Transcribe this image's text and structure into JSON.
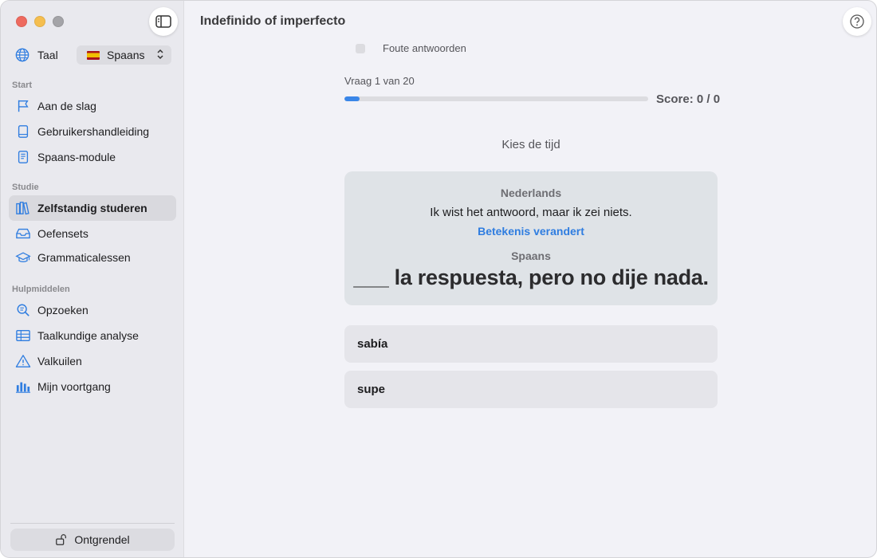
{
  "sidebar": {
    "language_label": "Taal",
    "language_value": "Spaans",
    "sections": {
      "start": "Start",
      "study": "Studie",
      "tools": "Hulpmiddelen"
    },
    "items": [
      {
        "label": "Aan de slag",
        "icon": "flag-icon"
      },
      {
        "label": "Gebruikershandleiding",
        "icon": "book-icon"
      },
      {
        "label": "Spaans-module",
        "icon": "document-icon"
      },
      {
        "label": "Zelfstandig studeren",
        "icon": "books-icon",
        "active": true
      },
      {
        "label": "Oefensets",
        "icon": "tray-icon"
      },
      {
        "label": "Grammaticalessen",
        "icon": "graduation-cap-icon"
      },
      {
        "label": "Opzoeken",
        "icon": "magnifier-icon"
      },
      {
        "label": "Taalkundige analyse",
        "icon": "table-icon"
      },
      {
        "label": "Valkuilen",
        "icon": "warning-icon"
      },
      {
        "label": "Mijn voortgang",
        "icon": "bar-chart-icon"
      }
    ],
    "unlock_label": "Ontgrendel"
  },
  "main": {
    "title": "Indefinido of imperfecto",
    "wrong_answers_label": "Foute antwoorden",
    "question_counter": "Vraag 1 van 20",
    "progress": 0.05,
    "score": "Score: 0 / 0",
    "prompt": "Kies de tijd",
    "card": {
      "source_lang": "Nederlands",
      "source_sentence": "Ik wist het antwoord, maar ik zei niets.",
      "meaning_note": "Betekenis verandert",
      "target_lang": "Spaans",
      "target_sentence": "___ la respuesta, pero no dije nada."
    },
    "options": [
      "sabía",
      "supe"
    ]
  },
  "colors": {
    "accent": "#3a86e8",
    "link": "#2f7de0",
    "sidebar_bg": "#e9e9ee",
    "main_bg": "#f2f2f7"
  }
}
